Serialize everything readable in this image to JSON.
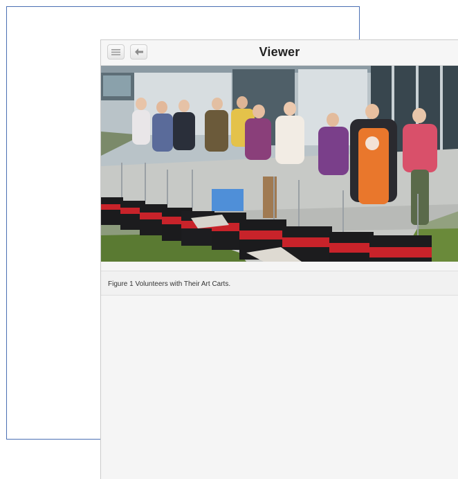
{
  "viewer": {
    "title": "Viewer",
    "menu_icon": "menu-icon",
    "back_icon": "back-arrow-icon"
  },
  "figure": {
    "caption": "Figure 1 Volunteers with Their Art Carts."
  },
  "colors": {
    "back_page_border": "#4a6fb3",
    "toolbar_bg": "#f6f6f6",
    "viewer_bg": "#f5f5f5"
  }
}
